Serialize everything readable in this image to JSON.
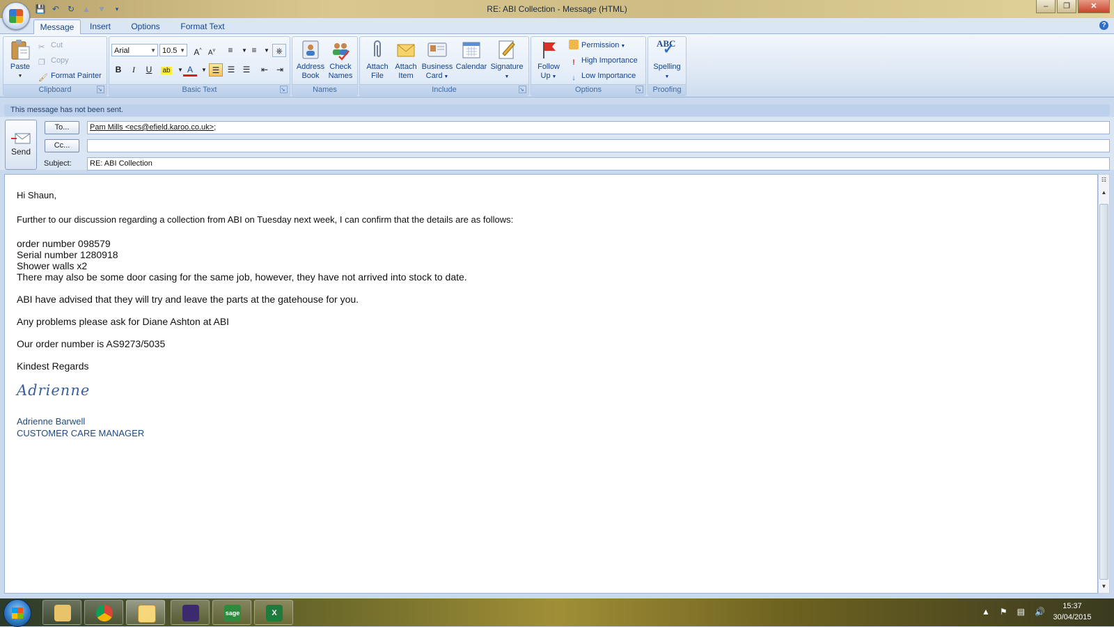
{
  "window": {
    "title": "RE: ABI Collection - Message (HTML)",
    "controls": [
      "minimize-icon",
      "restore-icon",
      "close-icon"
    ]
  },
  "tabs": [
    {
      "label": "Message",
      "active": true
    },
    {
      "label": "Insert",
      "active": false
    },
    {
      "label": "Options",
      "active": false
    },
    {
      "label": "Format Text",
      "active": false
    }
  ],
  "ribbon": {
    "clipboard": {
      "label": "Clipboard",
      "paste": "Paste",
      "cut": "Cut",
      "copy": "Copy",
      "format_painter": "Format Painter"
    },
    "basic_text": {
      "label": "Basic Text",
      "font": "Arial",
      "size": "10.5",
      "bold": "B",
      "italic": "I",
      "underline": "U",
      "font_color": "A"
    },
    "names": {
      "label": "Names",
      "address_book_l1": "Address",
      "address_book_l2": "Book",
      "check_names_l1": "Check",
      "check_names_l2": "Names"
    },
    "include": {
      "label": "Include",
      "attach_file_l1": "Attach",
      "attach_file_l2": "File",
      "attach_item_l1": "Attach",
      "attach_item_l2": "Item",
      "business_card_l1": "Business",
      "business_card_l2": "Card",
      "calendar": "Calendar",
      "signature": "Signature"
    },
    "options": {
      "label": "Options",
      "follow_up_l1": "Follow",
      "follow_up_l2": "Up",
      "permission": "Permission",
      "high_importance": "High Importance",
      "low_importance": "Low Importance"
    },
    "proofing": {
      "label": "Proofing",
      "spelling": "Spelling",
      "abc": "ABC"
    }
  },
  "compose": {
    "notice": "This message has not been sent.",
    "send": "Send",
    "to_button": "To...",
    "cc_button": "Cc...",
    "subject_label": "Subject:",
    "to_value": "Pam Mills <ecs@efield.karoo.co.uk>",
    "to_sep": ";",
    "cc_value": "",
    "subject_value": "RE: ABI Collection"
  },
  "body": {
    "greeting": "Hi Shaun,",
    "intro": "Further to our discussion regarding a collection from ABI on Tuesday next week,  I can confirm that the details are as follows:",
    "line_order": "order number 098579",
    "line_serial": "Serial number 1280918",
    "line_shower": "Shower walls x2",
    "line_casing": "There may also be some door casing for the same job, however, they have not arrived into stock to date.",
    "gatehouse": "ABI have advised that they will try and leave the parts at the gatehouse for you.",
    "problems": "Any problems please ask for Diane Ashton at ABI",
    "our_order": "Our order number is AS9273/5035",
    "regards": "Kindest Regards",
    "signature_script": "Adrienne",
    "sig_name": "Adrienne Barwell",
    "sig_title": "CUSTOMER CARE MANAGER"
  },
  "taskbar": {
    "apps": [
      "explorer",
      "chrome",
      "outlook",
      "calendar-app",
      "sage",
      "excel"
    ],
    "app_labels": {
      "sage": "sage",
      "excel": "X"
    },
    "time": "15:37",
    "date": "30/04/2015"
  },
  "colors": {
    "ribbon_text": "#15428b",
    "signature": "#1f497d",
    "tab_bar": "#dbe6f4"
  }
}
